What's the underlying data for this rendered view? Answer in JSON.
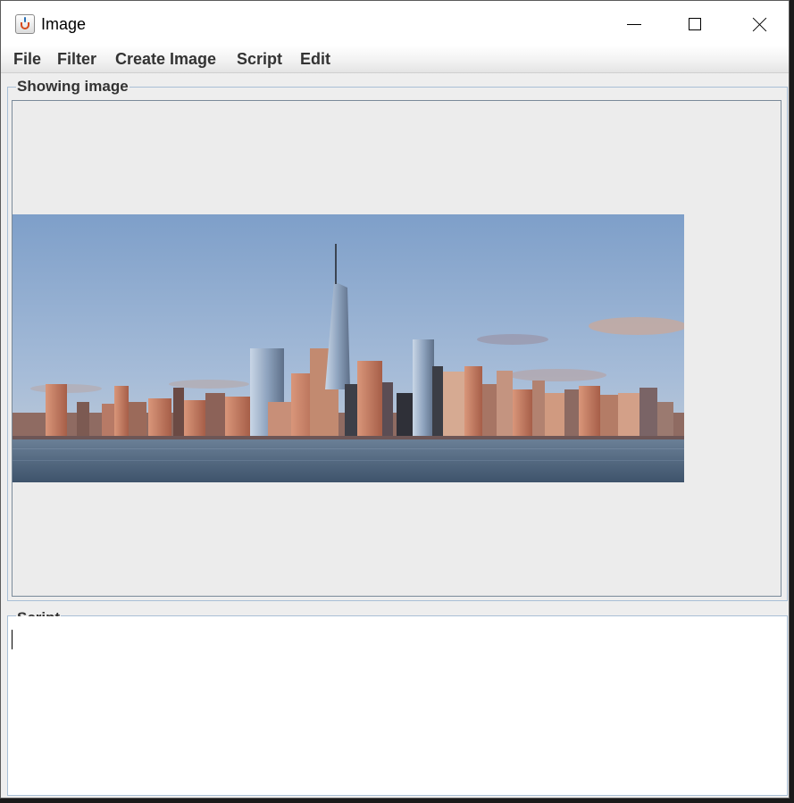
{
  "window": {
    "title": "Image",
    "icon": "java-coffee-cup-icon"
  },
  "menu": [
    "File",
    "Filter",
    "Create Image",
    "Script",
    "Edit"
  ],
  "image_panel": {
    "legend": "Showing image"
  },
  "script_panel": {
    "legend": "Script",
    "value": ""
  }
}
